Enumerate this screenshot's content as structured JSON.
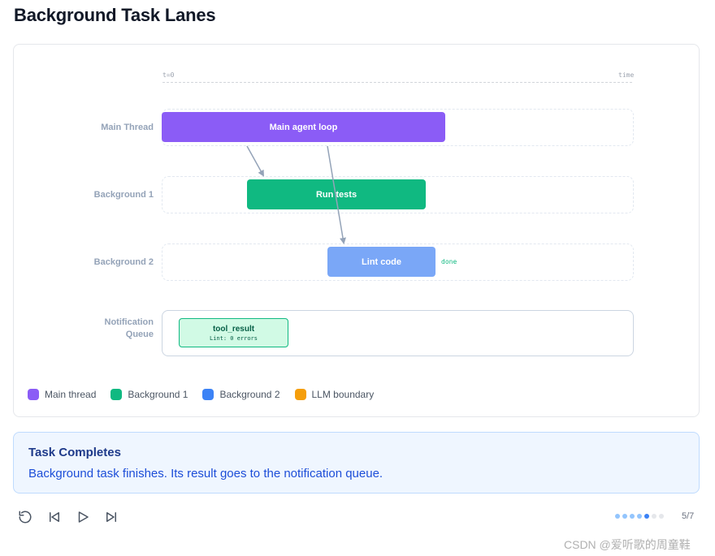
{
  "page": {
    "title": "Background Task Lanes"
  },
  "axis": {
    "start_label": "t=0",
    "end_label": "time"
  },
  "lanes": [
    {
      "label": "Main Thread"
    },
    {
      "label": "Background 1"
    },
    {
      "label": "Background 2"
    },
    {
      "label": "Notification Queue"
    }
  ],
  "tasks": {
    "main": {
      "label": "Main agent loop",
      "color": "#8b5cf6"
    },
    "bg1": {
      "label": "Run tests",
      "color": "#10b981"
    },
    "bg2": {
      "label": "Lint code",
      "color": "#7aa7f7",
      "status": "done"
    }
  },
  "queue_item": {
    "title": "tool_result",
    "detail": "Lint: 0 errors"
  },
  "legend": [
    {
      "label": "Main thread",
      "color": "#8b5cf6"
    },
    {
      "label": "Background 1",
      "color": "#10b981"
    },
    {
      "label": "Background 2",
      "color": "#3b82f6"
    },
    {
      "label": "LLM boundary",
      "color": "#f59e0b"
    }
  ],
  "step": {
    "title": "Task Completes",
    "description": "Background task finishes. Its result goes to the notification queue."
  },
  "controls": {
    "reset_icon": "reset-icon",
    "prev_icon": "skip-back-icon",
    "play_icon": "play-icon",
    "next_icon": "skip-forward-icon"
  },
  "progress": {
    "current": 5,
    "total": 7,
    "counter": "5/7"
  },
  "watermark": "CSDN @爱听歌的周童鞋"
}
